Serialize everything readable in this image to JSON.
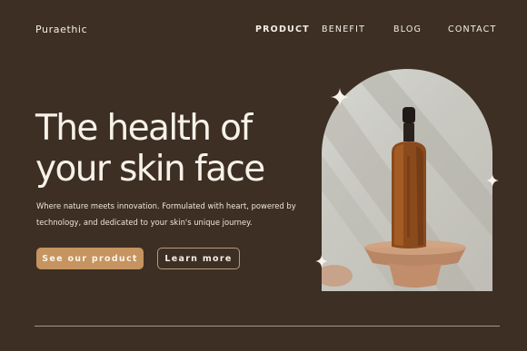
{
  "brand": "Puraethic",
  "nav": {
    "product": "PRODUCT",
    "benefit": "BENEFIT",
    "blog": "BLOG",
    "contact": "CONTACT"
  },
  "hero": {
    "headline_line1": "The health of",
    "headline_line2": "your skin face",
    "subtitle": "Where nature meets innovation. Formulated with heart, powered by technology, and dedicated to your skin's unique journey.",
    "primary_button": "See our product",
    "secondary_button": "Learn more"
  },
  "colors": {
    "background": "#3d2f24",
    "accent": "#c59460",
    "text": "#f4efe6"
  },
  "icons": [
    "sparkle-icon"
  ]
}
